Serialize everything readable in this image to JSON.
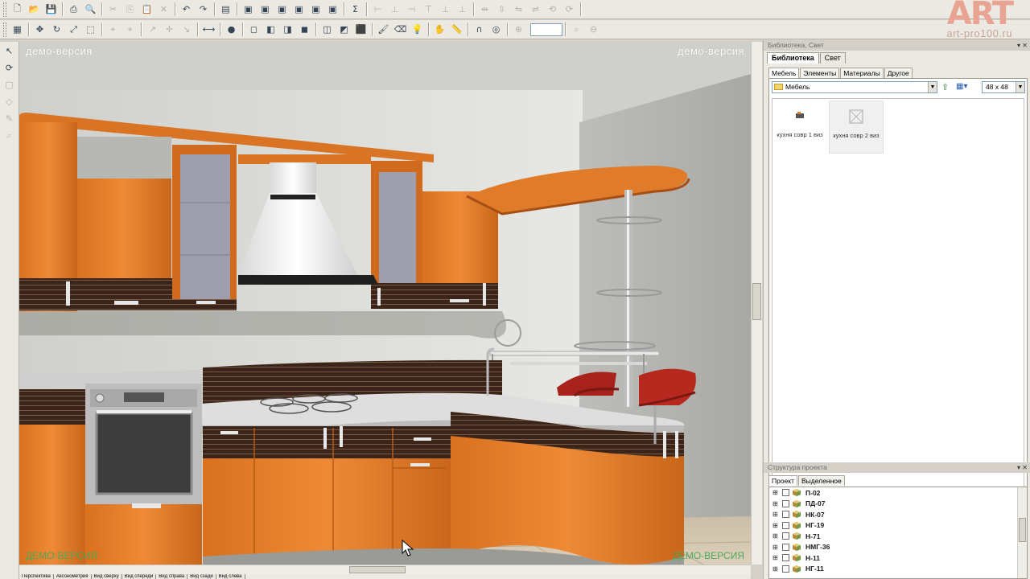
{
  "brand": {
    "logo": "ART",
    "url": "art-pro100.ru"
  },
  "viewport": {
    "watermark_top_left": "демо-версия",
    "watermark_top_right": "демо-версия",
    "watermark_bottom_left": "ДЕМО-ВЕРСИЯ",
    "watermark_bottom_right": "ДЕМО-ВЕРСИЯ",
    "view_tabs": [
      "Перспектива",
      "Аксонометрия",
      "Вид сверху",
      "Вид спереди",
      "Вид справа",
      "Вид сзади",
      "Вид слева"
    ]
  },
  "toolbar1": {
    "icons": [
      "new-file-icon",
      "open-folder-icon",
      "save-icon",
      "sep",
      "print-icon",
      "print-preview-icon",
      "sep",
      "cut-icon",
      "copy-icon",
      "paste-icon",
      "delete-icon",
      "sep",
      "undo-icon",
      "redo-icon",
      "sep",
      "properties-icon",
      "sep",
      "window-icon",
      "window2-icon",
      "window3-icon",
      "window4-icon",
      "window5-icon",
      "window6-icon",
      "sep",
      "sum-icon",
      "sep",
      "align-left-icon",
      "align-center-icon",
      "align-right-icon",
      "align-top-icon",
      "align-middle-icon",
      "align-bottom-icon",
      "sep",
      "distribute-h-icon",
      "distribute-v-icon",
      "mirror-icon",
      "mirror2-icon",
      "rotate-icon",
      "rotate2-icon",
      "sep"
    ]
  },
  "toolbar2": {
    "icons": [
      "grid-icon",
      "sep",
      "move-icon",
      "rotate3d-icon",
      "scale-icon",
      "select-icon",
      "sep",
      "snap-icon",
      "snap2-icon",
      "sep",
      "arrow-icon",
      "arrow2-icon",
      "arrow3-icon",
      "sep",
      "measure-icon",
      "sep",
      "stop-icon",
      "sep",
      "view-front-icon",
      "view-left-icon",
      "view-back-icon",
      "view-top-icon",
      "sep",
      "view-perspective-icon",
      "view-axon-icon",
      "view-cube-icon",
      "sep",
      "paint-icon",
      "eraser-icon",
      "light-icon",
      "sep",
      "hand-icon",
      "ruler-icon",
      "sep",
      "magnet-icon",
      "target-icon",
      "sep",
      "zoom-in-icon",
      "sep",
      "zoom-icon",
      "zoom-out-icon"
    ]
  },
  "library_panel": {
    "title": "Библиотека, Свет",
    "tabs": [
      "Библиотека",
      "Свет"
    ],
    "active_tab": "Библиотека",
    "subtabs": [
      "Мебель",
      "Элементы",
      "Материалы",
      "Другое"
    ],
    "active_subtab": "Мебель",
    "folder": "Мебель",
    "thumb_size": "48 x 48",
    "items": [
      {
        "label": "кухня совр 1 виз"
      },
      {
        "label": "кухня совр 2 виз"
      }
    ]
  },
  "structure_panel": {
    "title": "Структура проекта",
    "tabs": [
      "Проект",
      "Выделенное"
    ],
    "active_tab": "Проект",
    "rows": [
      "П-02",
      "ПД-07",
      "НК-07",
      "НГ-19",
      "Н-71",
      "НМГ-36",
      "Н-11",
      "НГ-11"
    ]
  },
  "colors": {
    "cabinet_orange": "#e07a28",
    "cabinet_dark": "#3a2218",
    "wall": "#d8d8d2",
    "floor": "#d2c4ae"
  }
}
